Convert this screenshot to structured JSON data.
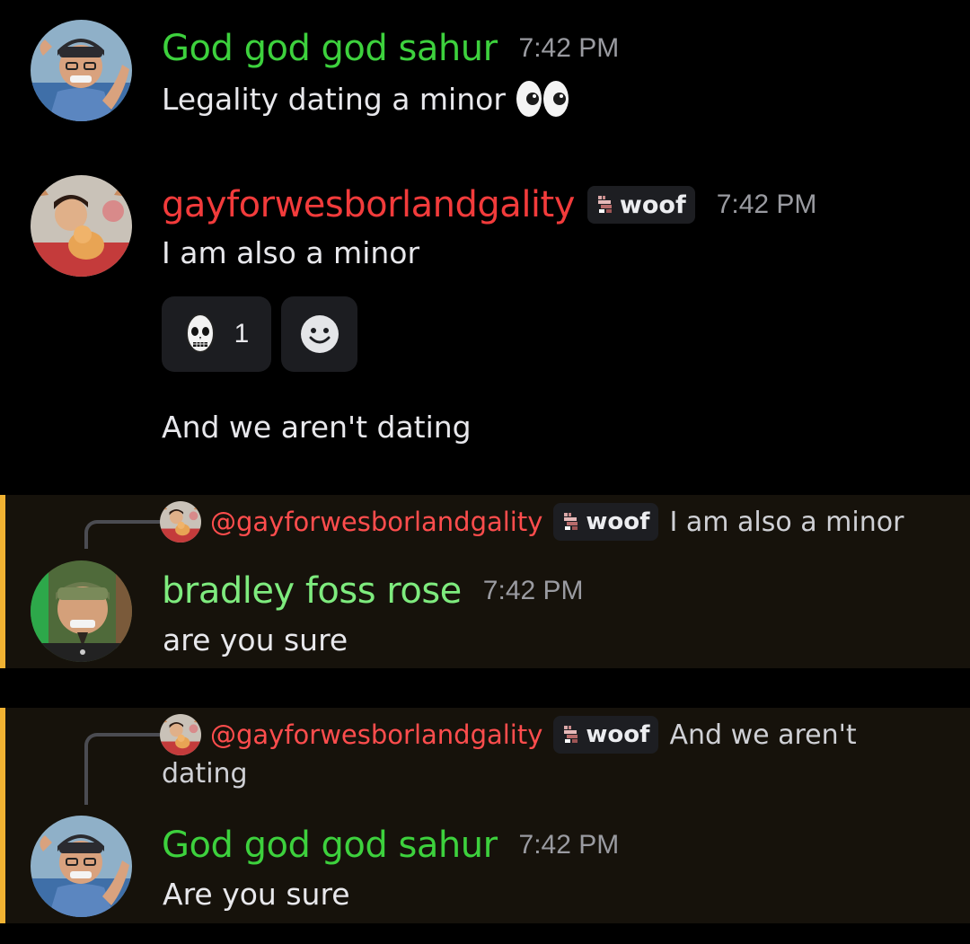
{
  "colors": {
    "green_user": "#3dd13d",
    "red_user": "#f23b3b",
    "light_green_user": "#7eeb7e",
    "highlight_bar": "#f0b232",
    "highlight_bg": "#16120b"
  },
  "messages": [
    {
      "username": "God god god sahur",
      "timestamp": "7:42 PM",
      "text": "Legality dating a minor",
      "emoji": "eyes-emoji"
    },
    {
      "username": "gayforwesborlandgality",
      "tag": "woof",
      "timestamp": "7:42 PM",
      "text": "I am also a minor",
      "reactions": [
        {
          "icon": "skull-mask-emoji",
          "count": "1"
        },
        {
          "icon": "add-reaction-icon"
        }
      ],
      "followup_text": "And we aren't dating"
    },
    {
      "reply_to": {
        "mention": "@gayforwesborlandgality",
        "tag": "woof",
        "text": "I am also a minor"
      },
      "username": "bradley foss rose",
      "timestamp": "7:42 PM",
      "text": "are you sure"
    },
    {
      "reply_to": {
        "mention": "@gayforwesborlandgality",
        "tag": "woof",
        "text_line1": "And we aren't",
        "text_line2": "dating"
      },
      "username": "God god god sahur",
      "timestamp": "7:42 PM",
      "text": "Are you sure"
    }
  ]
}
